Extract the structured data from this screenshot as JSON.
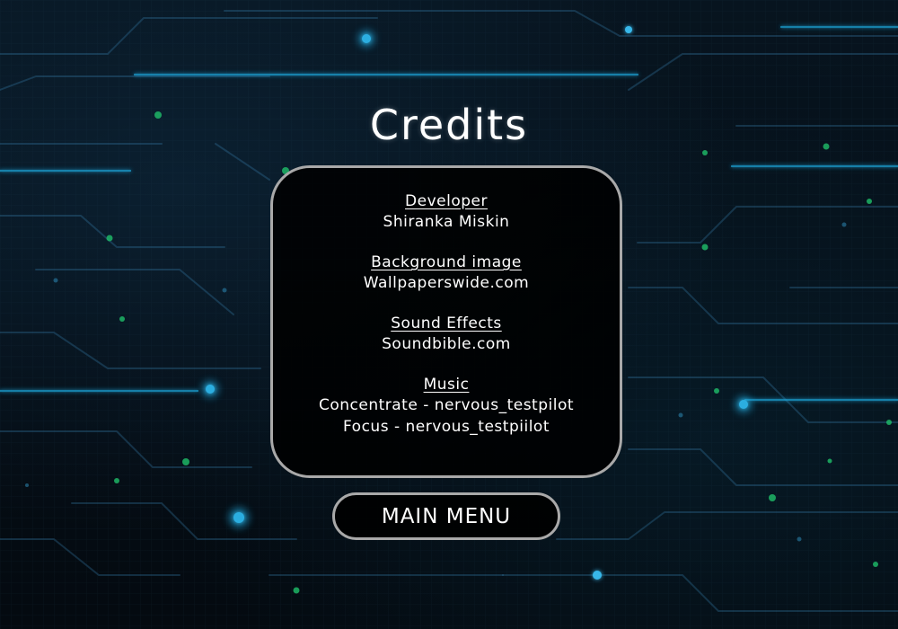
{
  "screen": {
    "title": "Credits"
  },
  "credits": {
    "sections": [
      {
        "heading": "Developer",
        "lines": [
          "Shiranka Miskin"
        ]
      },
      {
        "heading": "Background image",
        "lines": [
          "Wallpaperswide.com"
        ]
      },
      {
        "heading": "Sound Effects",
        "lines": [
          "Soundbible.com"
        ]
      },
      {
        "heading": "Music",
        "lines": [
          "Concentrate - nervous_testpilot",
          "Focus - nervous_testpiilot"
        ]
      }
    ]
  },
  "buttons": {
    "main_menu_label": "MAIN MENU"
  },
  "colors": {
    "text": "#ffffff",
    "panel_border": "#a9a9a9",
    "panel_fill": "#000000",
    "circuit_glow": "#1fa3d6",
    "dot_green": "#1fbf6a"
  }
}
